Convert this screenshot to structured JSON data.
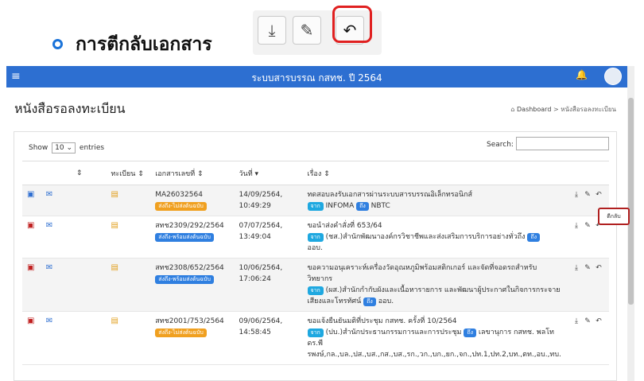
{
  "heading": "การตีกลับเอกสาร",
  "toolbar_icons": [
    "download-icon",
    "edit-icon",
    "return-icon"
  ],
  "app": {
    "title": "ระบบสารบรรณ กสทช. ปี 2564",
    "page_title": "หนังสือรอลงทะเบียน",
    "breadcrumb": {
      "home": "Dashboard",
      "sep": ">",
      "current": "หนังสือรอลงทะเบียน"
    },
    "show_label": "Show",
    "entries_value": "10",
    "entries_label": "entries",
    "search_label": "Search:",
    "columns": [
      "",
      "",
      "",
      "ทะเบียน",
      "เอกสารเลขที่",
      "วันที่",
      "เรื่อง",
      ""
    ],
    "tooltip": "ตีกลับ",
    "rows": [
      {
        "doc_no": "MA26032564",
        "status": "ส่งถึง-ไม่ส่งต้นฉบับ",
        "status_color": "#f0a020",
        "date": "14/09/2564,",
        "time": "10:49:29",
        "subject": "ทดสอบลงรับเอกสารผ่านระบบสารบรรณอิเล็กทรอนิกส์",
        "from_badge": "จาก",
        "from": "INFOMA",
        "to_badge": "ถึง",
        "to": "NBTC",
        "more": ""
      },
      {
        "doc_no": "สทช2309/292/2564",
        "status": "ส่งถึง-พร้อมส่งต้นฉบับ",
        "status_color": "#2f7fe0",
        "date": "07/07/2564,",
        "time": "13:49:04",
        "subject": "ขอนำส่งคำสั่งที่ 653/64",
        "from_badge": "จาก",
        "from": "(ชส.)สำนักพัฒนาองค์กรวิชาชีพและส่งเสริมการบริการอย่างทั่วถึง",
        "to_badge": "ถึง",
        "to": "",
        "more": "ออบ."
      },
      {
        "doc_no": "สทช2308/652/2564",
        "status": "ส่งถึง-พร้อมส่งต้นฉบับ",
        "status_color": "#2f7fe0",
        "date": "10/06/2564,",
        "time": "17:06:24",
        "subject": "ขอความอนุเคราะห์เครื่องวัดอุณหภูมิพร้อมสติกเกอร์ และจัดที่จอดรถสำหรับวิทยากร",
        "from_badge": "จาก",
        "from": "(ผส.)สำนักกำกับผังและเนื้อหารายการ และพัฒนาผู้ประกาศในกิจการกระจายเสียงและโทรทัศน์",
        "to_badge": "ถึง",
        "to": "ออบ.",
        "more": ""
      },
      {
        "doc_no": "สทช2001/753/2564",
        "status": "ส่งถึง-ไม่ส่งต้นฉบับ",
        "status_color": "#f0a020",
        "date": "09/06/2564,",
        "time": "14:58:45",
        "subject": "ขอแจ้งยืนยันมติที่ประชุม กสทช. ครั้งที่ 10/2564",
        "from_badge": "จาก",
        "from": "(ปบ.)สำนักประธานกรรมการและการประชุม",
        "to_badge": "ถึง",
        "to": "เลขานุการ กสทช. พลโท ดร.พี",
        "more": "รพงษ์,กล.,บล.,ปส.,บส.,กส.,บส.,รก.,วก.,บก.,ยก.,จก.,ปท.1,ปท.2,บท.,ตท.,อบ.,ทบ."
      }
    ]
  }
}
